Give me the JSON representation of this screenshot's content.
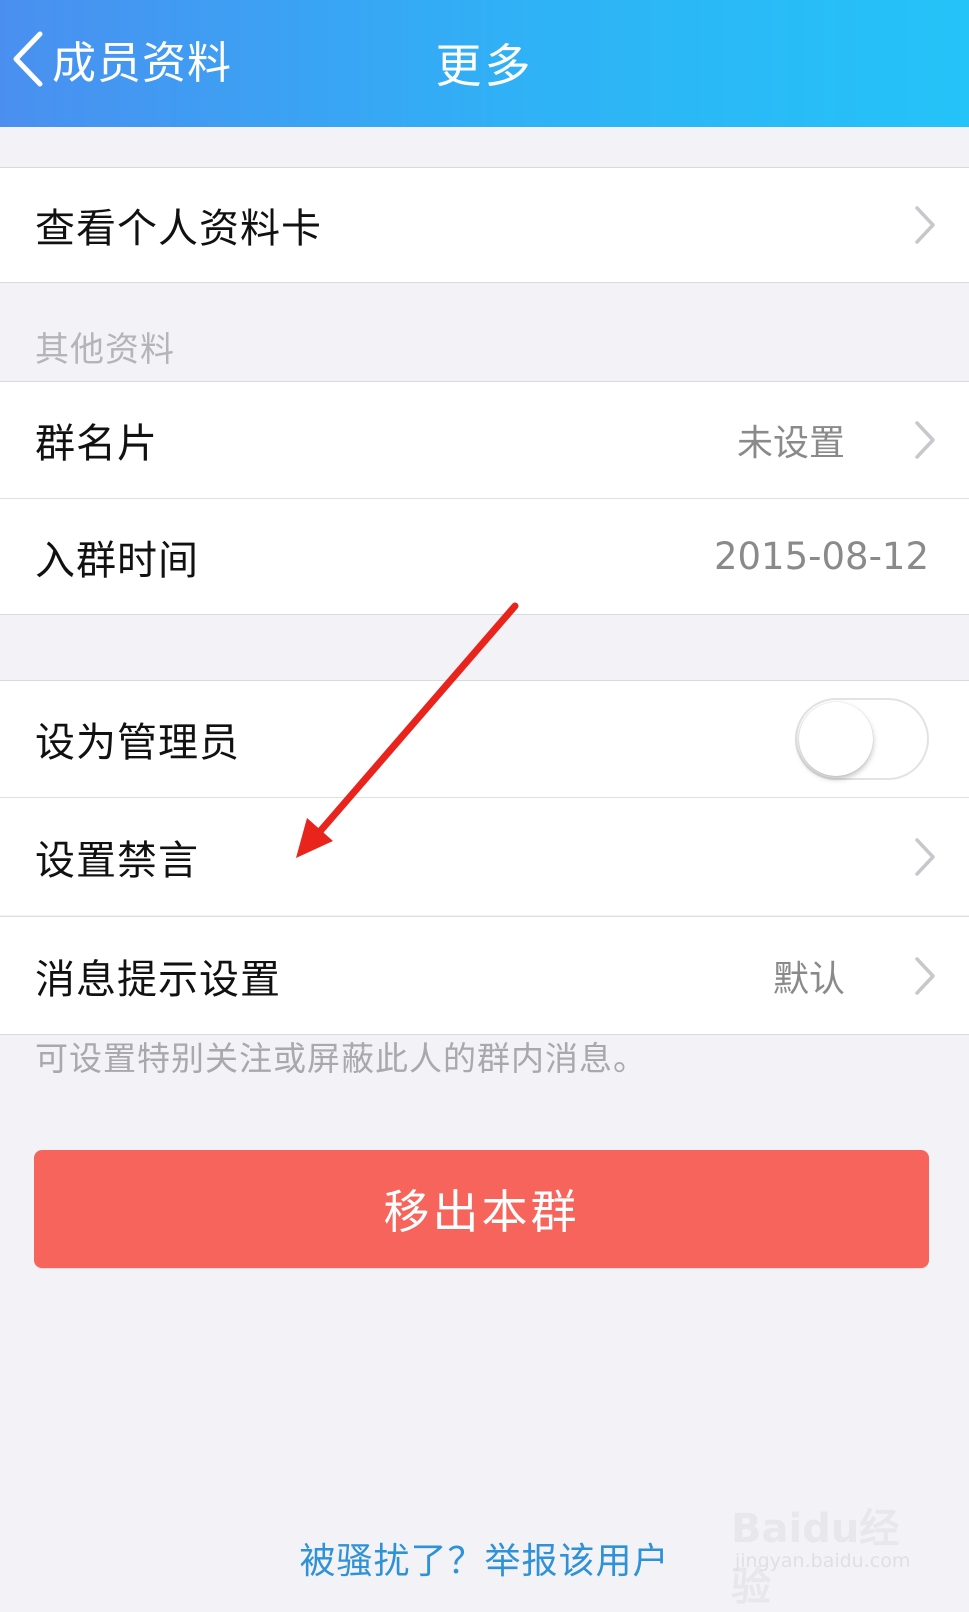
{
  "header": {
    "back_label": "成员资料",
    "title": "更多",
    "gradient_start": "#4a8ff0",
    "gradient_end": "#24c3f8"
  },
  "profile_card": {
    "label": "查看个人资料卡",
    "icon": "chevron-right-icon"
  },
  "other_info": {
    "section_title": "其他资料",
    "group_card": {
      "label": "群名片",
      "value": "未设置",
      "icon": "chevron-right-icon"
    },
    "join_time": {
      "label": "入群时间",
      "value": "2015-08-12"
    }
  },
  "settings": {
    "set_admin": {
      "label": "设为管理员",
      "enabled": false
    },
    "mute": {
      "label": "设置禁言",
      "icon": "chevron-right-icon"
    },
    "message_notify": {
      "label": "消息提示设置",
      "value": "默认",
      "icon": "chevron-right-icon"
    },
    "footnote": "可设置特别关注或屏蔽此人的群内消息。"
  },
  "remove_button": {
    "label": "移出本群",
    "color": "#f7645b"
  },
  "report_link": "被骚扰了？举报该用户",
  "link_color": "#2f92d6",
  "annotation_arrow_color": "#e8241c",
  "watermark": {
    "logo": "Baidu经验",
    "url": "jingyan.baidu.com"
  }
}
